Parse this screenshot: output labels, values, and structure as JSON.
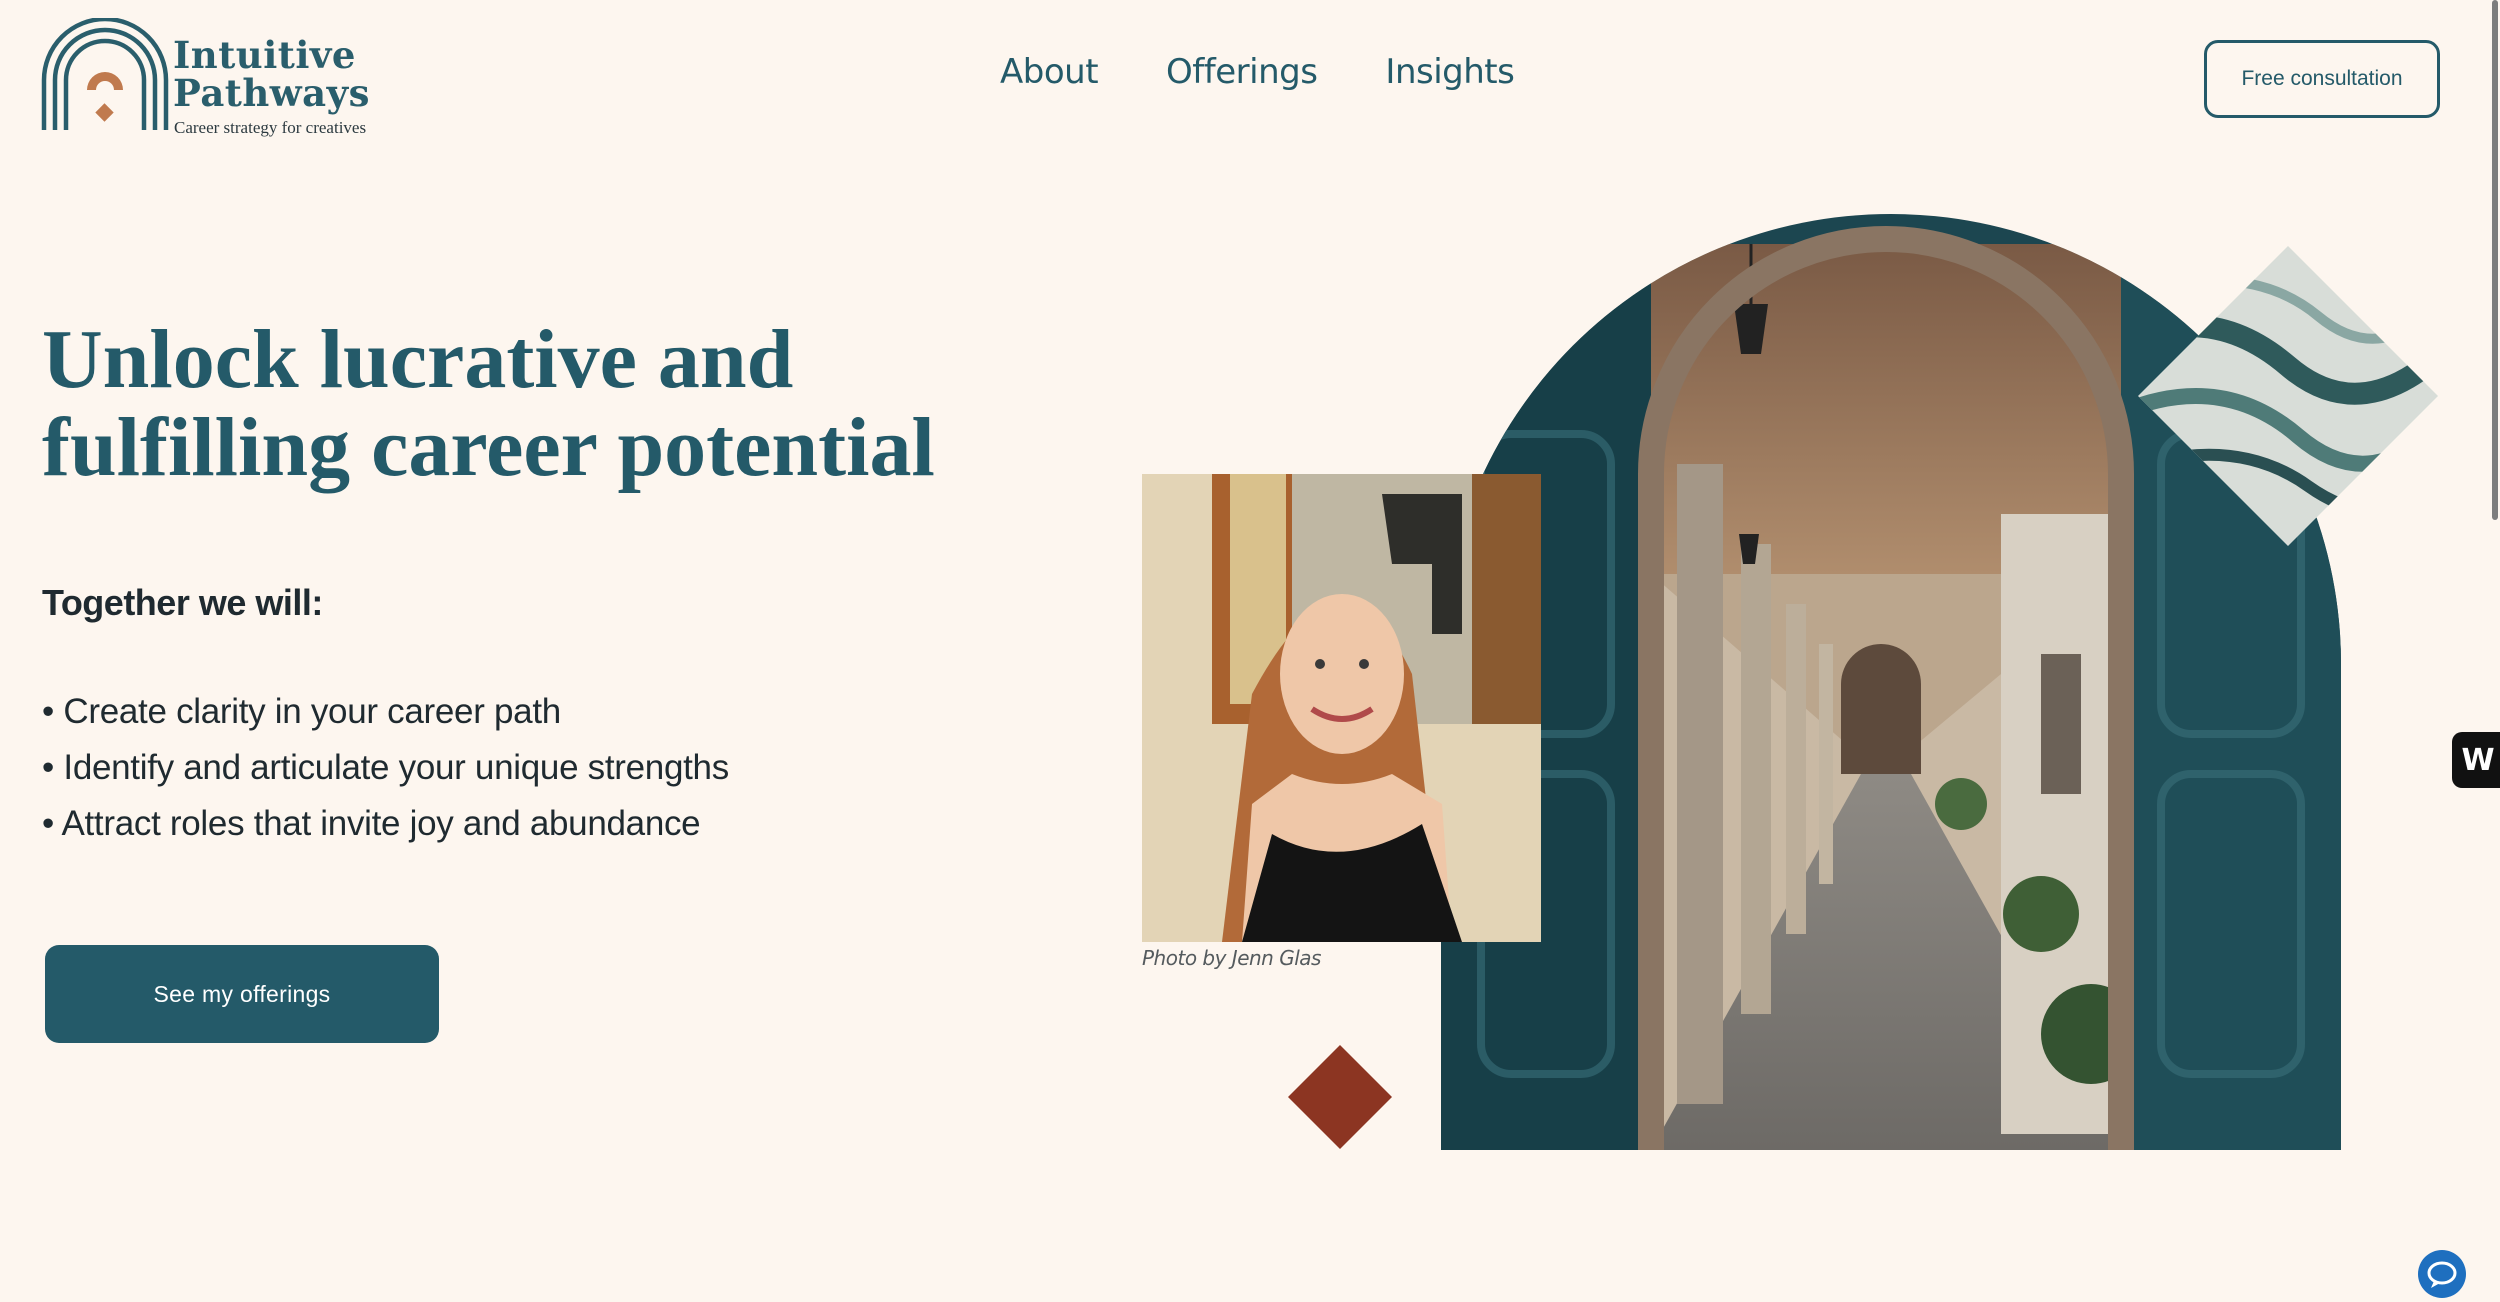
{
  "brand": {
    "name_line1": "Intuitive",
    "name_line2": "Pathways",
    "tagline": "Career strategy for creatives"
  },
  "nav": {
    "items": [
      {
        "label": "About"
      },
      {
        "label": "Offerings"
      },
      {
        "label": "Insights"
      }
    ],
    "cta_label": "Free consultation"
  },
  "hero": {
    "headline_line1": "Unlock lucrative and",
    "headline_line2": "fulfilling career potential",
    "subhead": "Together we will:",
    "bullets": [
      "Create clarity in your career path",
      "Identify and articulate your unique strengths",
      "Attract roles that invite joy and abundance"
    ],
    "cta_label": "See my offerings",
    "photo_credit": "Photo by Jenn Glas"
  },
  "widgets": {
    "badge_label": "W"
  },
  "colors": {
    "background": "#fdf6ef",
    "primary_teal": "#245a69",
    "accent_rust": "#b86a3d",
    "accent_red": "#8c3522",
    "text_dark": "#1f2a30"
  },
  "icons": {
    "logo": "rainbow-arch-logo-icon",
    "chat": "chat-bubble-icon"
  }
}
